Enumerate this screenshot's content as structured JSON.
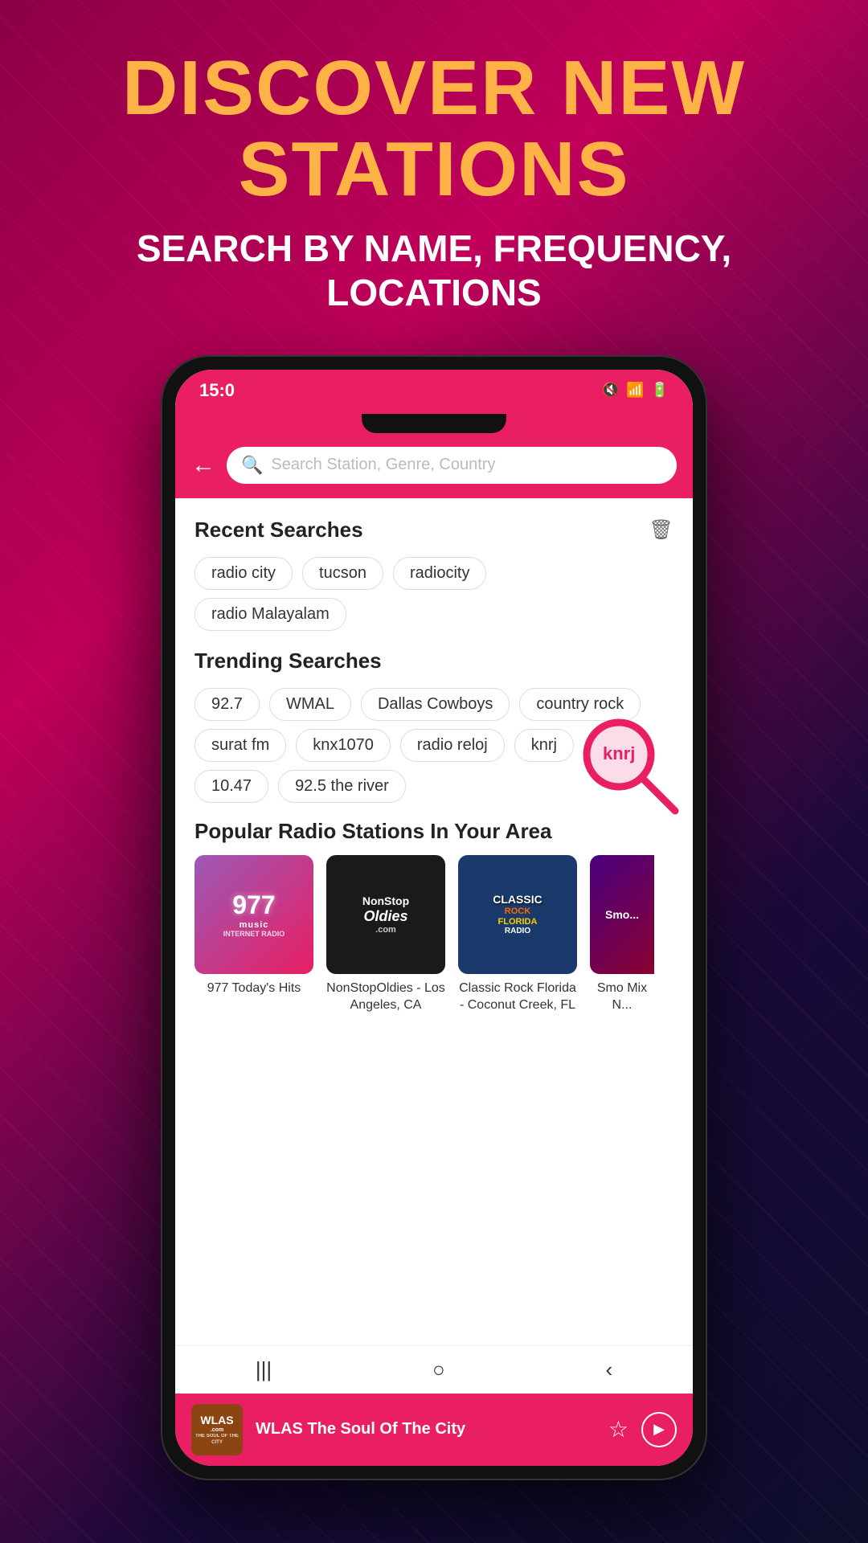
{
  "background": {
    "gradient_start": "#8B0045",
    "gradient_end": "#0d0d2b"
  },
  "headline": {
    "title": "DISCOVER NEW STATIONS",
    "subtitle": "SEARCH BY NAME, FREQUENCY, LOCATIONS"
  },
  "phone": {
    "status_bar": {
      "time": "15:0",
      "icons": [
        "mute",
        "wifi",
        "signal",
        "battery"
      ]
    },
    "search": {
      "placeholder": "Search Station, Genre, Country",
      "back_label": "←"
    },
    "recent_searches": {
      "title": "Recent Searches",
      "tags": [
        "radio city",
        "tucson",
        "radiocity",
        "radio Malayalam"
      ]
    },
    "trending_searches": {
      "title": "Trending Searches",
      "tags": [
        "92.7",
        "WMAL",
        "Dallas Cowboys",
        "country rock",
        "surat fm",
        "knx1070",
        "radio reloj",
        "knrj",
        "10.47",
        "92.5 the river"
      ]
    },
    "popular_stations": {
      "title": "Popular Radio Stations In Your Area",
      "stations": [
        {
          "name": "977 Today's Hits",
          "logo_text": "977 music INTERNET RADIO",
          "color1": "#9b59b6",
          "color2": "#e91e63"
        },
        {
          "name": "NonStopOldies - Los Angeles, CA",
          "logo_text": "NonStop Oldies .com",
          "color1": "#1a1a1a",
          "color2": "#222"
        },
        {
          "name": "Classic Rock Florida - Coconut Creek, FL",
          "logo_text": "CLASSIC ROCK FLORIDA RADIO",
          "color1": "#1a3a6b",
          "color2": "#2a4a8b"
        },
        {
          "name": "Smooth Mix N...",
          "logo_text": "Smooth",
          "color1": "#4a0080",
          "color2": "#8b0030"
        }
      ]
    },
    "player": {
      "station_name": "WLAS The Soul Of The City",
      "logo_text": "WLAS"
    },
    "nav": {
      "items": [
        "|||",
        "○",
        "<"
      ]
    }
  },
  "trash_icon": "🗑",
  "delete_label": "Delete"
}
